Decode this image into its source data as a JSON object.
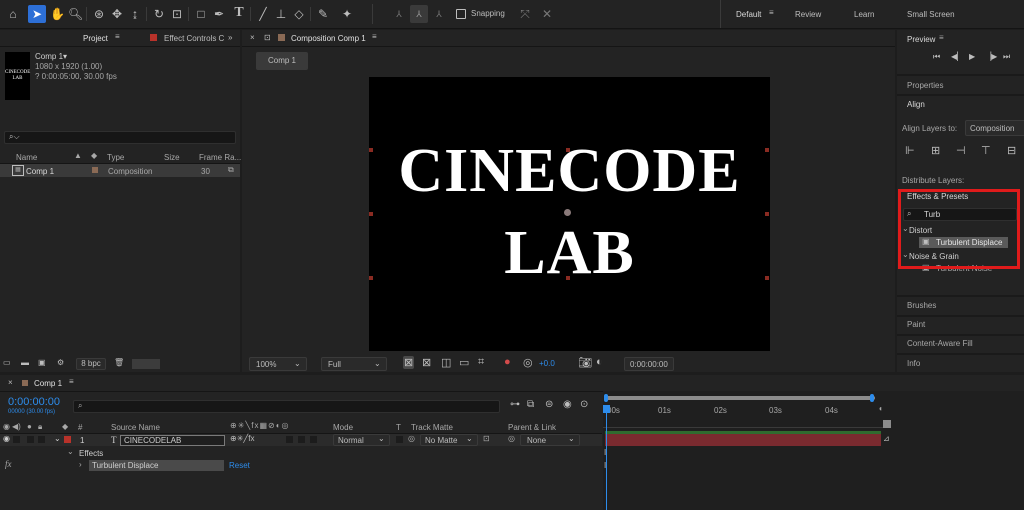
{
  "toolbar": {
    "snapping_label": "Snapping",
    "workspaces": [
      "Default",
      "Review",
      "Learn",
      "Small Screen"
    ]
  },
  "project": {
    "tab_project": "Project",
    "tab_effect_controls": "Effect Controls C",
    "thumbnail_text": [
      "CINECODE",
      "LAB"
    ],
    "comp_name": "Comp 1▾",
    "comp_size": "1080 x 1920 (1.00)",
    "comp_duration": "? 0:00:05:00, 30.00 fps",
    "search_glyph": "⌕⌵",
    "columns": [
      "Name",
      "Type",
      "Size",
      "Frame Ra..."
    ],
    "rows": [
      {
        "name": "Comp 1",
        "type": "Composition",
        "size": "",
        "fps": "30"
      }
    ],
    "bpc": "8 bpc"
  },
  "composition": {
    "tab_label": "Composition Comp 1",
    "subtab": "Comp 1",
    "canvas_text": [
      "CINECODE",
      "LAB"
    ],
    "zoom": "100%",
    "resolution": "Full",
    "exposure": "+0.0",
    "timecode": "0:00:00:00"
  },
  "right": {
    "preview_label": "Preview",
    "properties_label": "Properties",
    "align_label": "Align",
    "align_layers_to": "Align Layers to:",
    "align_target": "Composition",
    "distribute_layers": "Distribute Layers:",
    "effects_presets": "Effects & Presets",
    "search_value": "Turb",
    "tree": [
      {
        "category": "Distort",
        "item": "Turbulent Displace",
        "selected": true
      },
      {
        "category": "Noise & Grain",
        "item": "Turbulent Noise",
        "selected": false
      }
    ],
    "panels": [
      "Brushes",
      "Paint",
      "Content-Aware Fill",
      "Info"
    ]
  },
  "timeline": {
    "tab_label": "Comp 1",
    "timecode": "0:00:00:00",
    "frame_info": "00000 (30.00 fps)",
    "headers": {
      "num": "#",
      "source_name": "Source Name",
      "mode": "Mode",
      "t": "T",
      "track_matte": "Track Matte",
      "parent_link": "Parent & Link"
    },
    "layer": {
      "index": "1",
      "type_glyph": "T",
      "name": "CINECODELAB",
      "mode": "Normal",
      "matte": "No Matte",
      "parent": "None"
    },
    "effects_label": "Effects",
    "effect_name": "Turbulent Displace",
    "reset_label": "Reset",
    "fx_label": "fx",
    "ruler": [
      "00s",
      "01s",
      "02s",
      "03s",
      "04s"
    ]
  },
  "colors": {
    "accent": "#2d8ceb",
    "highlight_box": "#e01b1b",
    "label_red": "#b8322a",
    "layer_bar": "#7a2a2f"
  }
}
